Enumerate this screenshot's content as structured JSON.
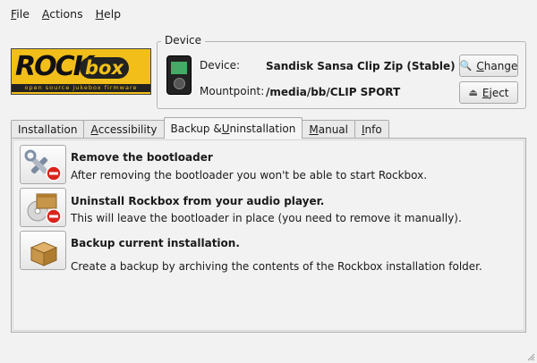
{
  "menubar": {
    "items": [
      {
        "label": "File",
        "mnemonic": "F",
        "rest": "ile"
      },
      {
        "label": "Actions",
        "mnemonic": "A",
        "rest": "ctions"
      },
      {
        "label": "Help",
        "mnemonic": "H",
        "rest": "elp"
      }
    ]
  },
  "logo": {
    "wordmark_left": "ROCK",
    "wordmark_right": "box",
    "tagline": "open source jukebox firmware"
  },
  "device": {
    "group_title": "Device",
    "device_label": "Device:",
    "device_value": "Sandisk Sansa Clip Zip (Stable)",
    "mountpoint_label": "Mountpoint:",
    "mountpoint_value": "/media/bb/CLIP SPORT",
    "change_button": {
      "before": "",
      "mnemonic": "C",
      "after": "hange"
    },
    "eject_button": {
      "before": "",
      "mnemonic": "E",
      "after": "ject"
    }
  },
  "tabs": [
    {
      "before": "Installation",
      "mnemonic": "",
      "after": ""
    },
    {
      "before": "",
      "mnemonic": "A",
      "after": "ccessibility"
    },
    {
      "before": "Backup & ",
      "mnemonic": "U",
      "after": "ninstallation"
    },
    {
      "before": "",
      "mnemonic": "M",
      "after": "anual"
    },
    {
      "before": "",
      "mnemonic": "I",
      "after": "nfo"
    }
  ],
  "active_tab": 2,
  "actions": [
    {
      "title": "Remove the bootloader",
      "description": "After removing the bootloader you won't be able to start Rockbox.",
      "icon": "tools-remove-icon"
    },
    {
      "title": "Uninstall Rockbox from your audio player.",
      "description": "This will leave the bootloader in place (you need to remove it manually).",
      "icon": "package-remove-icon"
    },
    {
      "title": "Backup current installation.",
      "description": "Create a backup by archiving the contents of the Rockbox installation folder.",
      "icon": "package-icon"
    }
  ],
  "colors": {
    "logo_bg": "#f2bf1a",
    "remove_red": "#d9241c"
  }
}
